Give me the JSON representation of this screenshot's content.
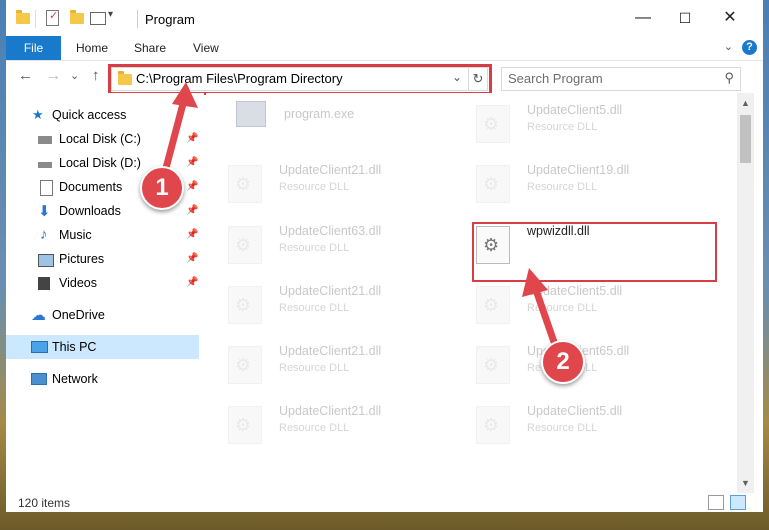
{
  "titlebar": {
    "title": "Program",
    "minimize": "—",
    "maximize": "☐",
    "close": "✕"
  },
  "ribbon": {
    "file": "File",
    "home": "Home",
    "share": "Share",
    "view": "View",
    "help": "?"
  },
  "nav": {
    "back": "←",
    "forward": "→",
    "up_recent": "⌄",
    "up": "↑",
    "address": "C:\\Program Files\\Program Directory",
    "refresh": "↻",
    "search_placeholder": "Search Program"
  },
  "sidebar": {
    "items": [
      {
        "label": "Quick access"
      },
      {
        "label": "Local Disk (C:)"
      },
      {
        "label": "Local Disk (D:)"
      },
      {
        "label": "Documents"
      },
      {
        "label": "Downloads"
      },
      {
        "label": "Music"
      },
      {
        "label": "Pictures"
      },
      {
        "label": "Videos"
      },
      {
        "label": "OneDrive"
      },
      {
        "label": "This PC"
      },
      {
        "label": "Network"
      }
    ]
  },
  "files": [
    {
      "name": "program.exe",
      "type": ""
    },
    {
      "name": "UpdateClient5.dll",
      "type": "Resource DLL"
    },
    {
      "name": "UpdateClient21.dll",
      "type": "Resource DLL"
    },
    {
      "name": "UpdateClient19.dll",
      "type": "Resource DLL"
    },
    {
      "name": "UpdateClient63.dll",
      "type": "Resource DLL"
    },
    {
      "name": "wpwizdll.dll",
      "type": ""
    },
    {
      "name": "UpdateClient21.dll",
      "type": "Resource DLL"
    },
    {
      "name": "UpdateClient5.dll",
      "type": "Resource DLL"
    },
    {
      "name": "UpdateClient21.dll",
      "type": "Resource DLL"
    },
    {
      "name": "UpdateClient65.dll",
      "type": "Resource DLL"
    },
    {
      "name": "UpdateClient21.dll",
      "type": "Resource DLL"
    },
    {
      "name": "UpdateClient5.dll",
      "type": "Resource DLL"
    }
  ],
  "status": {
    "items": "120 items"
  },
  "annotations": {
    "step1": "1",
    "step2": "2"
  },
  "colors": {
    "accent": "#1979ca",
    "highlight": "#d93d44",
    "selected": "#cce8ff"
  }
}
